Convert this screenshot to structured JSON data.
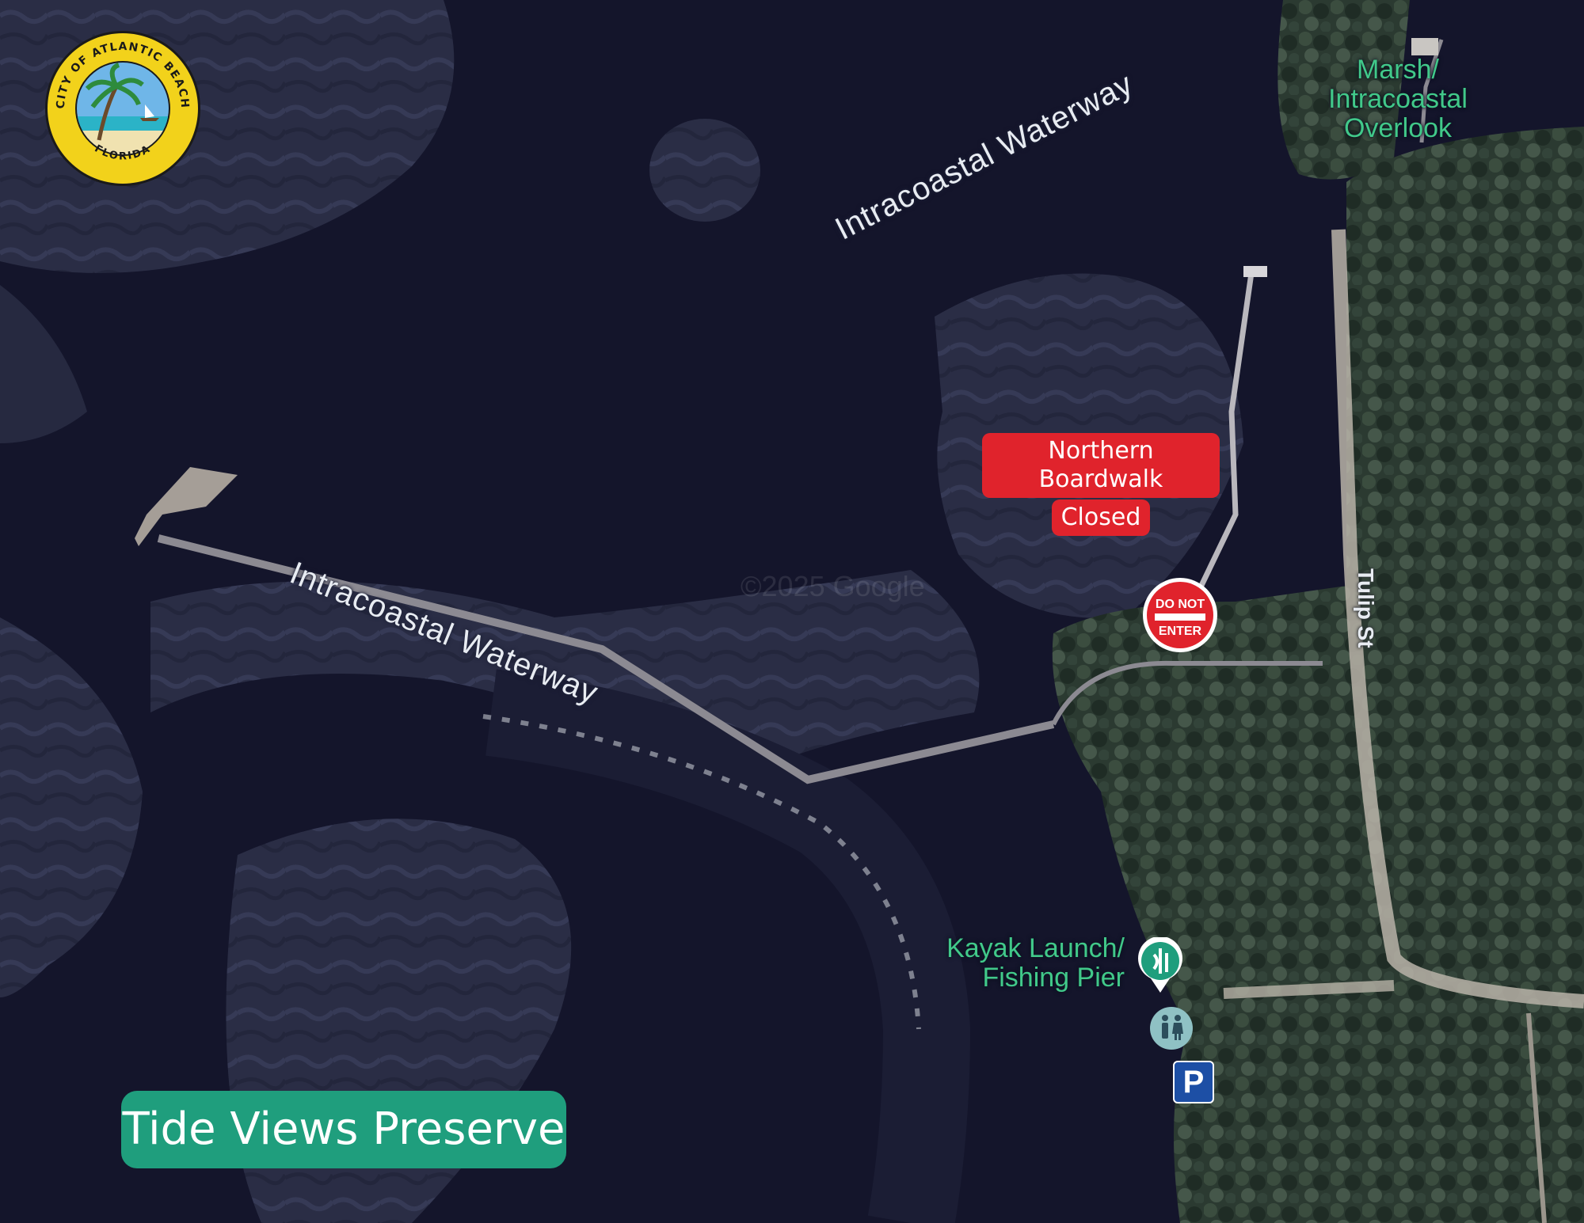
{
  "map": {
    "water_labels": [
      "Intracoastal Waterway",
      "Intracoastal Waterway"
    ],
    "street_label": "Tulip St",
    "poi_marsh_line1": "Marsh/",
    "poi_marsh_line2": "Intracoastal",
    "poi_marsh_line3": "Overlook",
    "poi_kayak_line1": "Kayak Launch/",
    "poi_kayak_line2": "Fishing Pier",
    "watermark": "©2025 Google",
    "closure_line1": "Northern Boardwalk",
    "closure_line2": "Closed",
    "dne_top": "DO NOT",
    "dne_bottom": "ENTER",
    "parking_letter": "P",
    "title": "Tide Views Preserve"
  },
  "logo": {
    "ring_text_top": "CITY OF ATLANTIC BEACH",
    "ring_text_bottom": "FLORIDA",
    "icon": "palm-tree-seal-icon"
  },
  "colors": {
    "water": "#14152b",
    "closure_red": "#e0232c",
    "title_green": "#1f9e7d",
    "poi_green": "#41c98a",
    "parking_blue": "#1d4fa5"
  }
}
